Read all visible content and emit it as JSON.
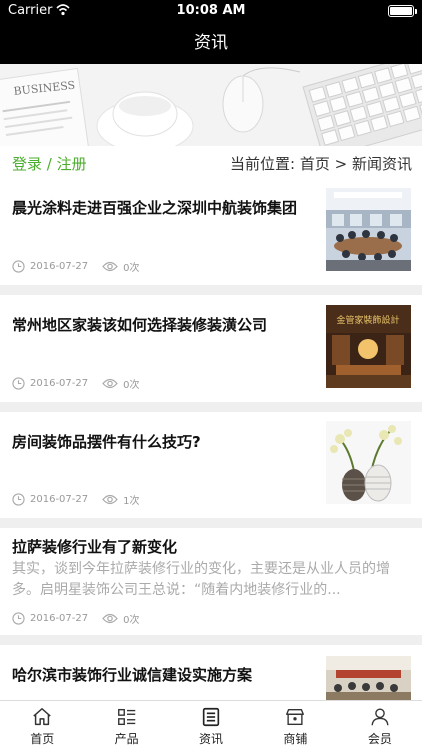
{
  "status_bar": {
    "carrier": "Carrier",
    "time": "10:08 AM"
  },
  "nav": {
    "title": "资讯"
  },
  "banner": {
    "text": "BUSINESS"
  },
  "breadcrumb": {
    "login": "登录",
    "separator": " / ",
    "register": "注册",
    "location_label": "当前位置:",
    "home": "首页",
    "arrow": ">",
    "current": "新闻资讯"
  },
  "articles": [
    {
      "title": "晨光涂料走进百强企业之深圳中航装饰集团",
      "date": "2016-07-27",
      "views": "0次"
    },
    {
      "title": "常州地区家装该如何选择装修装潢公司",
      "date": "2016-07-27",
      "views": "0次",
      "thumb_sign": "金管家裝飾設計"
    },
    {
      "title": "房间装饰品摆件有什么技巧?",
      "date": "2016-07-27",
      "views": "1次"
    },
    {
      "title": "拉萨装修行业有了新变化",
      "date": "2016-07-27",
      "views": "0次",
      "summary": "其实，谈到今年拉萨装修行业的变化，主要还是从业人员的增多。启明星装饰公司王总说：“随着内地装修行业的..."
    },
    {
      "title": "哈尔滨市装饰行业诚信建设实施方案"
    }
  ],
  "tabs": [
    {
      "label": "首页",
      "icon": "home-icon"
    },
    {
      "label": "产品",
      "icon": "grid-list-icon"
    },
    {
      "label": "资讯",
      "icon": "news-icon"
    },
    {
      "label": "商铺",
      "icon": "shop-icon"
    },
    {
      "label": "会员",
      "icon": "user-icon"
    }
  ],
  "colors": {
    "accent": "#4cae2e",
    "nav_bg": "#000000"
  }
}
